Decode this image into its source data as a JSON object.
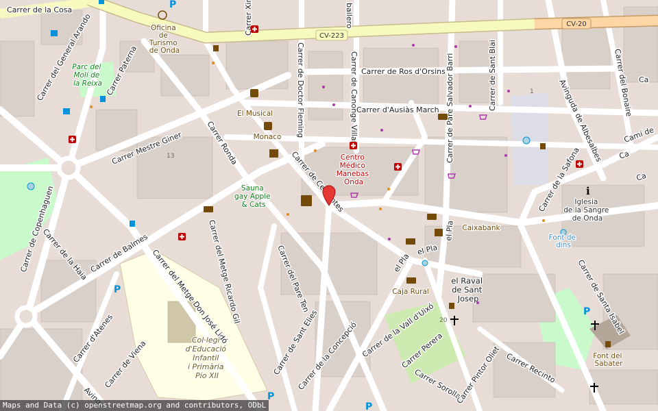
{
  "map": {
    "streets": [
      {
        "id": "carrer-de-la-cosa",
        "name": "Carrer de la Cosa"
      },
      {
        "id": "carrer-del-general-arando",
        "name": "Carrer del General Arando"
      },
      {
        "id": "carrer-paterna",
        "name": "Carrer Paterna"
      },
      {
        "id": "carrer-ximeno",
        "name": "Carrer Ximeno"
      },
      {
        "id": "carrer-doctor-fleming",
        "name": "Carrer de Doctor Fleming"
      },
      {
        "id": "carrer-canonge-villar",
        "name": "Carrer de Canonge Villar"
      },
      {
        "id": "carrer-ros-dorsins",
        "name": "Carrer de Ros d'Orsins"
      },
      {
        "id": "carrer-ausias-march",
        "name": "Carrer d'Ausiàs March"
      },
      {
        "id": "carrer-salvador-barri",
        "name": "Carrer de Pare Salvador Barri"
      },
      {
        "id": "carrer-sant-blai",
        "name": "Carrer de Sant Blai"
      },
      {
        "id": "avinguda-albesalbes",
        "name": "Avinguda de Albesalbes"
      },
      {
        "id": "carrer-bonaire",
        "name": "Carrer del Bonaire"
      },
      {
        "id": "carrer-mestre-giner",
        "name": "Carrer Mestre Giner"
      },
      {
        "id": "carrer-ronda",
        "name": "Carrer Ronda"
      },
      {
        "id": "carrer-cervantes",
        "name": "Carrer de Cervantes"
      },
      {
        "id": "carrer-copenhaguen",
        "name": "Carrer de Copenhaguen"
      },
      {
        "id": "carrer-la-haia",
        "name": "Carrer de la Haia"
      },
      {
        "id": "carrer-balmes",
        "name": "Carrer de Balmes"
      },
      {
        "id": "carrer-metge-don-jose-llido",
        "name": "Carrer del Metge Don José Lidó"
      },
      {
        "id": "carrer-metge-ricardo-gil",
        "name": "Carrer del Metge Ricardo Gil"
      },
      {
        "id": "carrer-pare-ten",
        "name": "Carrer del Pare Ten"
      },
      {
        "id": "carrer-atenes",
        "name": "Carrer d'Atenes"
      },
      {
        "id": "carrer-viena",
        "name": "Carrer de Viena"
      },
      {
        "id": "carrer-sant-elies",
        "name": "Carrer de Sant Elies"
      },
      {
        "id": "carrer-concepcio",
        "name": "Carrer de la Concepció"
      },
      {
        "id": "carrer-vall-uixo",
        "name": "Carrer de la Vall d'Uixó"
      },
      {
        "id": "carrer-perera",
        "name": "Carrer Perera"
      },
      {
        "id": "carrer-sorolla",
        "name": "Carrer Sorolla"
      },
      {
        "id": "carrer-pintor-oliet",
        "name": "Carrer Pintor Oliet"
      },
      {
        "id": "carrer-recinto",
        "name": "Carrer Recinto"
      },
      {
        "id": "carrer-santa-isabel",
        "name": "Carrer de Santa Isabel"
      },
      {
        "id": "carrer-safona",
        "name": "Carrer de la Safona"
      },
      {
        "id": "cami-de",
        "name": "Camí de"
      },
      {
        "id": "carrer-del-pla",
        "name": "el Pla"
      },
      {
        "id": "carrer-avinguda-partial",
        "name": "Avingu"
      },
      {
        "id": "carrer-bailero",
        "name": "bailero"
      },
      {
        "id": "carrer-cai",
        "name": "Ca"
      },
      {
        "id": "carrer-ca-right",
        "name": "Ca"
      },
      {
        "id": "carrer-vi-right",
        "name": "Ca"
      }
    ],
    "roads": [
      {
        "id": "cv-223",
        "ref": "CV-223"
      },
      {
        "id": "cv-20",
        "ref": "CV-20"
      }
    ],
    "places": [
      {
        "id": "oficina-turismo",
        "name": "Oficina\nde\nTurismo\nde Onda"
      },
      {
        "id": "parc-moli-reixa",
        "name": "Parc del\nMolí de\nla Reixa"
      },
      {
        "id": "el-musical",
        "name": "El Musical"
      },
      {
        "id": "monaco",
        "name": "Monaco"
      },
      {
        "id": "centro-medico",
        "name": "Centro\nMédico\nManebas\nOnda"
      },
      {
        "id": "sauna-gay",
        "name": "Sauna\ngay Apple\n& Cats"
      },
      {
        "id": "caixabank",
        "name": "Caixabank"
      },
      {
        "id": "iglesia-sangre",
        "name": "Iglesia\nde la Sangre\nde Onda"
      },
      {
        "id": "font-de-dins",
        "name": "Font de\ndins"
      },
      {
        "id": "el-raval",
        "name": "el Raval\nde Sant\nJosep"
      },
      {
        "id": "caja-rural",
        "name": "Caja Rural"
      },
      {
        "id": "colegi",
        "name": "Col·legi\nd'Educació\nInfantil\ni Primària\nPío XII"
      },
      {
        "id": "font-sabater",
        "name": "Font del\nSabater"
      }
    ],
    "house_numbers": [
      "13",
      "20",
      "1"
    ],
    "colors": {
      "land": "#e8dcd7",
      "building": "#d9d0c9",
      "road": "#ffffff",
      "primary_road": "#f7fabf",
      "trunk_road": "#fcd6a4",
      "park": "#c8facc",
      "school": "#ffffe5",
      "water": "#aad3df",
      "poi_brown": "#734a08",
      "poi_red": "#bf0000",
      "poi_purple": "#ac39ac",
      "poi_blue": "#0092da",
      "marker": "#e53935"
    },
    "marker": {
      "icon": "map-pin-icon"
    }
  },
  "attribution": "Maps and Data (c) openstreetmap.org and contributors, ODbL"
}
